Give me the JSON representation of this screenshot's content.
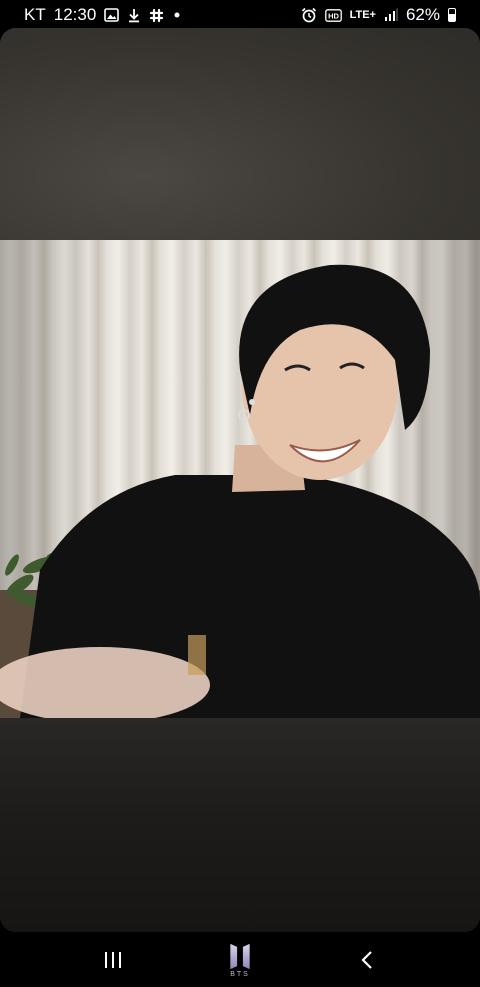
{
  "status_bar": {
    "carrier": "KT",
    "time": "12:30",
    "left_icons": [
      "image-icon",
      "download-icon",
      "slack-icon",
      "dot-icon"
    ],
    "right_icons": [
      "alarm-icon",
      "hd-icon",
      "lte-icon",
      "signal-icon"
    ],
    "network": "LTE+",
    "battery_percent": "62%",
    "battery_level": 0.62
  },
  "video": {
    "content": "video-still"
  },
  "nav_bar": {
    "recents_icon": "recents-icon",
    "home_logo": "bts-logo-icon",
    "home_label": "BTS",
    "back_icon": "back-icon"
  },
  "colors": {
    "background": "#000000",
    "frame_top": "#3a3833",
    "frame_bottom": "#161514",
    "logo_accent": "#bfbad6"
  }
}
